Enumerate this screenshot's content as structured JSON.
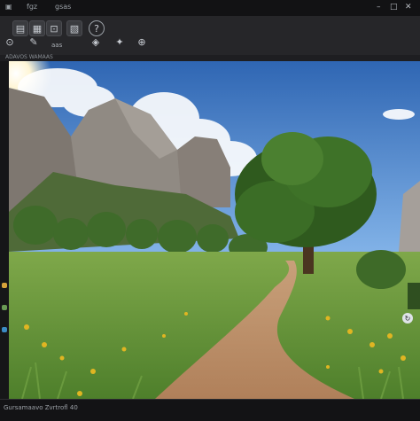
{
  "window": {
    "menu": [
      "fgz",
      "gsas"
    ],
    "controls": {
      "minimize": "–",
      "maximize": "□",
      "close": "✕"
    }
  },
  "toolbar": {
    "icon_names": [
      "zoom-tool-icon",
      "brush-tool-icon",
      "layers-icon",
      "settings-icon",
      "move-tool-icon"
    ],
    "label": "aas"
  },
  "pathbar": {
    "text": "ADAVOS WAMAAS"
  },
  "statusbar": {
    "text": "Gursamaavo Zvrtrofl 40"
  },
  "colors": {
    "accent": "#1aa7d8",
    "frame": "#262629"
  }
}
